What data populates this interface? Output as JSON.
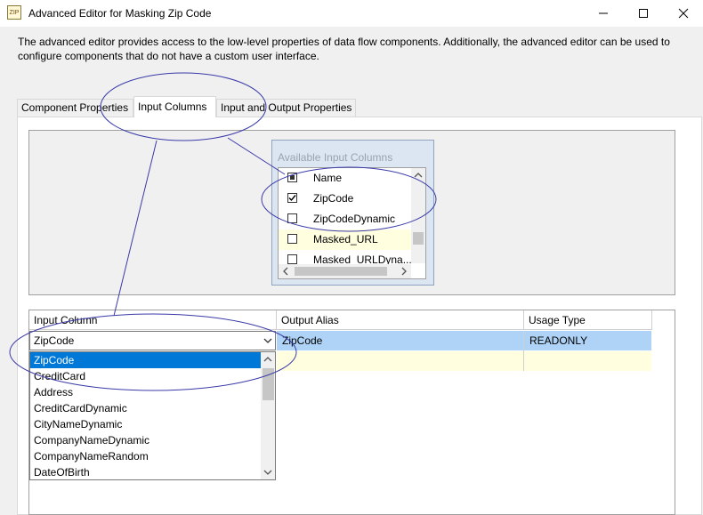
{
  "window": {
    "title": "Advanced Editor for Masking Zip Code",
    "icon_text": "ZIP"
  },
  "description": "The advanced editor provides access to the low-level properties of data flow components. Additionally, the advanced editor can be used to configure components that do not have a custom user interface.",
  "tabs": [
    {
      "label": "Component Properties"
    },
    {
      "label": "Input Columns"
    },
    {
      "label": "Input and Output Properties"
    }
  ],
  "available_columns": {
    "title": "Available Input Columns",
    "header": "Name",
    "items": [
      {
        "label": "ZipCode",
        "checked": true
      },
      {
        "label": "ZipCodeDynamic",
        "checked": false
      },
      {
        "label": "Masked_URL",
        "checked": false
      },
      {
        "label": "Masked_URLDyna...",
        "checked": false
      }
    ]
  },
  "grid": {
    "columns": [
      "Input Column",
      "Output Alias",
      "Usage Type"
    ],
    "rows": [
      {
        "input": "ZipCode",
        "alias": "ZipCode",
        "usage": "READONLY"
      }
    ]
  },
  "dropdown": {
    "selected": "ZipCode",
    "options": [
      "ZipCode",
      "CreditCard",
      "Address",
      "CreditCardDynamic",
      "CityNameDynamic",
      "CompanyNameDynamic",
      "CompanyNameRandom",
      "DateOfBirth"
    ]
  },
  "colors": {
    "selection": "#0078d7",
    "row_highlight": "#aed3f6",
    "annotation": "#3a3aa8"
  }
}
